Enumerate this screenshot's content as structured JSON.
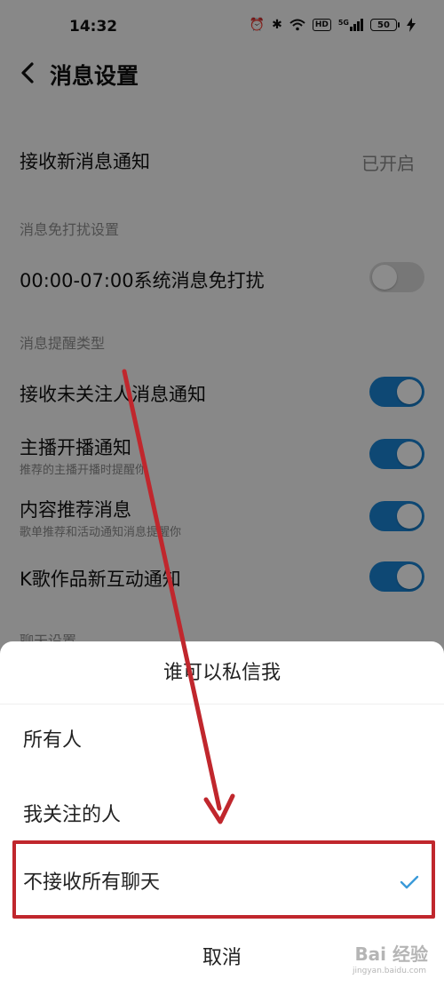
{
  "status_bar": {
    "time": "14:32",
    "icons": [
      "alarm-icon",
      "bluetooth-icon",
      "wifi-icon",
      "hd-icon",
      "signal-icon",
      "battery-icon",
      "charging-icon"
    ],
    "hd": "HD",
    "signal": "5G",
    "battery": "50"
  },
  "header": {
    "title": "消息设置"
  },
  "settings": {
    "receive_new": {
      "label": "接收新消息通知",
      "value": "已开启"
    },
    "dnd_section": "消息免打扰设置",
    "dnd": {
      "label": "00:00-07:00系统消息免打扰",
      "on": false
    },
    "remind_section": "消息提醒类型",
    "items": [
      {
        "label": "接收未关注人消息通知",
        "sub": "",
        "on": true
      },
      {
        "label": "主播开播通知",
        "sub": "推荐的主播开播时提醒你",
        "on": true
      },
      {
        "label": "内容推荐消息",
        "sub": "歌单推荐和活动通知消息提醒你",
        "on": true
      },
      {
        "label": "K歌作品新互动通知",
        "sub": "",
        "on": true
      }
    ],
    "chat_section": "聊天设置"
  },
  "sheet": {
    "title": "谁可以私信我",
    "options": [
      {
        "label": "所有人",
        "selected": false
      },
      {
        "label": "我关注的人",
        "selected": false
      },
      {
        "label": "不接收所有聊天",
        "selected": true
      }
    ],
    "cancel": "取消"
  },
  "colors": {
    "accent": "#1a84d4",
    "highlight": "#c0272d",
    "check": "#3a9ad9"
  },
  "watermark": {
    "brand": "Bai 经验",
    "url": "jingyan.baidu.com"
  }
}
